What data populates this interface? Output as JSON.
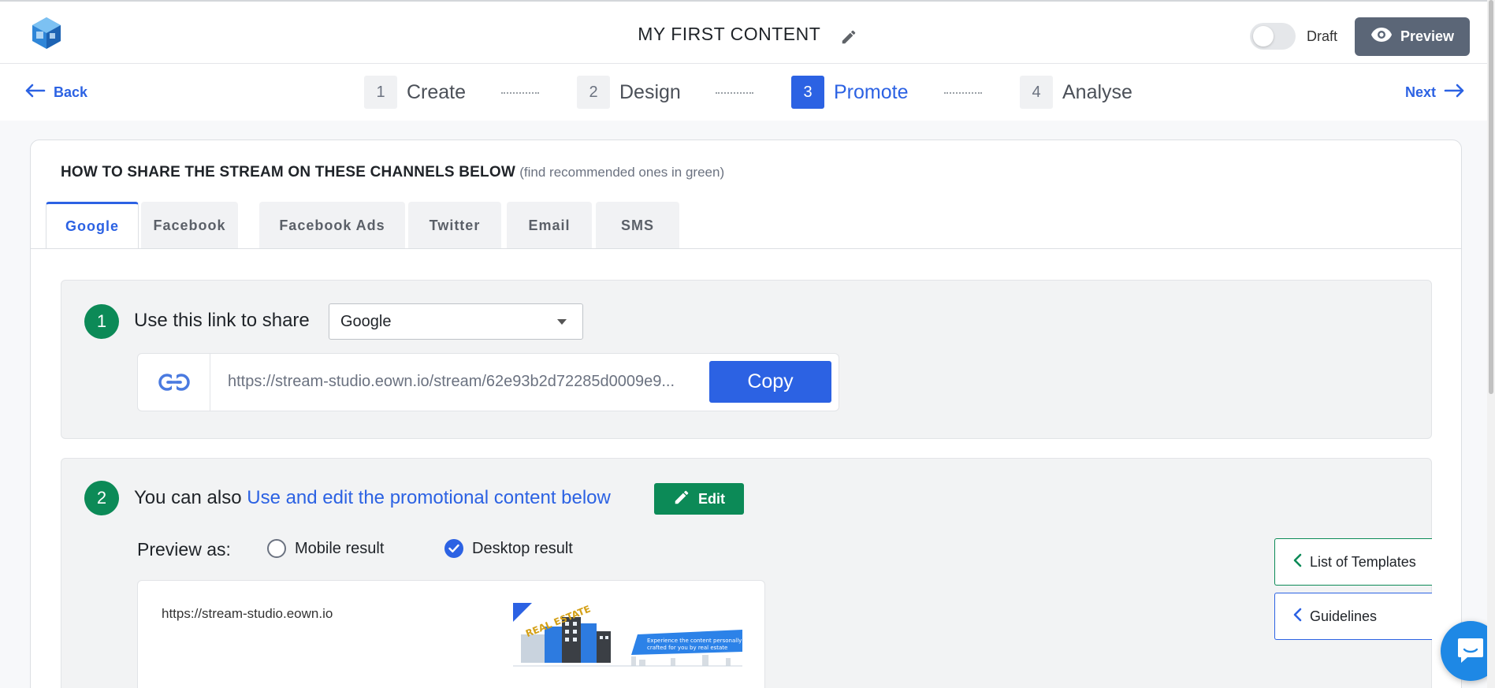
{
  "header": {
    "title": "MY FIRST CONTENT",
    "draft_label": "Draft",
    "preview_label": "Preview"
  },
  "stepper": {
    "back_label": "Back",
    "next_label": "Next",
    "steps": [
      {
        "num": "1",
        "label": "Create"
      },
      {
        "num": "2",
        "label": "Design"
      },
      {
        "num": "3",
        "label": "Promote"
      },
      {
        "num": "4",
        "label": "Analyse"
      }
    ],
    "active_step": 3
  },
  "share": {
    "heading": "HOW TO SHARE THE STREAM ON THESE CHANNELS BELOW",
    "heading_note": "(find recommended ones in green)",
    "tabs": [
      "Google",
      "Facebook",
      "Facebook Ads",
      "Twitter",
      "Email",
      "SMS"
    ],
    "active_tab": "Google"
  },
  "step1": {
    "number": "1",
    "title": "Use this link to share",
    "select_value": "Google",
    "url": "https://stream-studio.eown.io/stream/62e93b2d72285d0009e9...",
    "copy_label": "Copy"
  },
  "step2": {
    "number": "2",
    "title_prefix": "You can also",
    "title_link": "Use and edit the promotional content below",
    "edit_label": "Edit",
    "preview_as_label": "Preview as:",
    "mobile_label": "Mobile result",
    "desktop_label": "Desktop result",
    "selected_preview": "Desktop result",
    "preview_url": "https://stream-studio.eown.io"
  },
  "thumbnail": {
    "title": "REAL ESTATE",
    "banner_text_line1": "Experience the content personally",
    "banner_text_line2": "crafted for you by real estate"
  },
  "side": {
    "templates_label": "List of Templates",
    "guidelines_label": "Guidelines"
  },
  "colors": {
    "primary": "#2c62e3",
    "success": "#0c8a57",
    "preview_button": "#5b6677"
  }
}
